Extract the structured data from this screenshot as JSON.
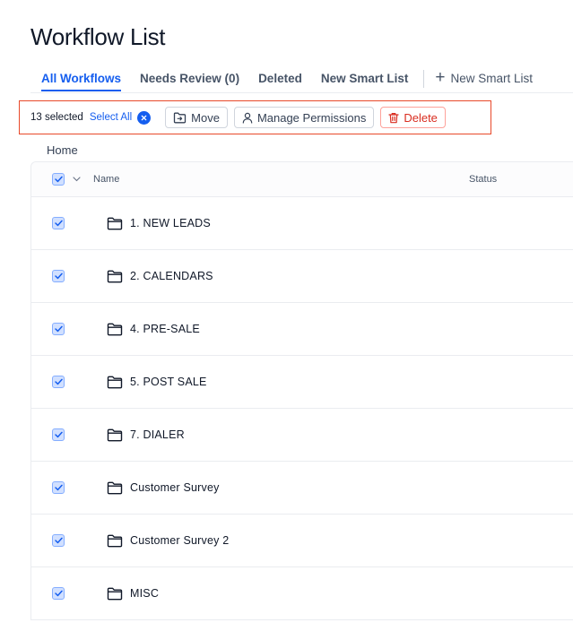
{
  "page": {
    "title": "Workflow List"
  },
  "tabs": [
    {
      "label": "All Workflows",
      "active": true
    },
    {
      "label": "Needs Review (0)",
      "active": false
    },
    {
      "label": "Deleted",
      "active": false
    },
    {
      "label": "New Smart List",
      "active": false
    }
  ],
  "add_tab": {
    "label": "New Smart List",
    "icon": "plus-icon"
  },
  "selection": {
    "count_text": "13 selected",
    "select_all": "Select All",
    "clear_icon": "close-circle-icon",
    "actions": {
      "move": "Move",
      "manage_permissions": "Manage Permissions",
      "delete": "Delete"
    }
  },
  "breadcrumb": "Home",
  "table": {
    "columns": {
      "name": "Name",
      "status": "Status"
    },
    "header_checked": true,
    "rows": [
      {
        "name": "1. NEW LEADS",
        "checked": true,
        "icon": "folder-icon"
      },
      {
        "name": "2. CALENDARS",
        "checked": true,
        "icon": "folder-icon"
      },
      {
        "name": "4. PRE-SALE",
        "checked": true,
        "icon": "folder-icon"
      },
      {
        "name": "5. POST SALE",
        "checked": true,
        "icon": "folder-icon"
      },
      {
        "name": "7. DIALER",
        "checked": true,
        "icon": "folder-icon"
      },
      {
        "name": "Customer Survey",
        "checked": true,
        "icon": "folder-icon"
      },
      {
        "name": "Customer Survey 2",
        "checked": true,
        "icon": "folder-icon"
      },
      {
        "name": "MISC",
        "checked": true,
        "icon": "folder-icon"
      }
    ]
  },
  "colors": {
    "accent": "#155eef",
    "danger": "#d92d20",
    "highlight_border": "#e8492a"
  }
}
